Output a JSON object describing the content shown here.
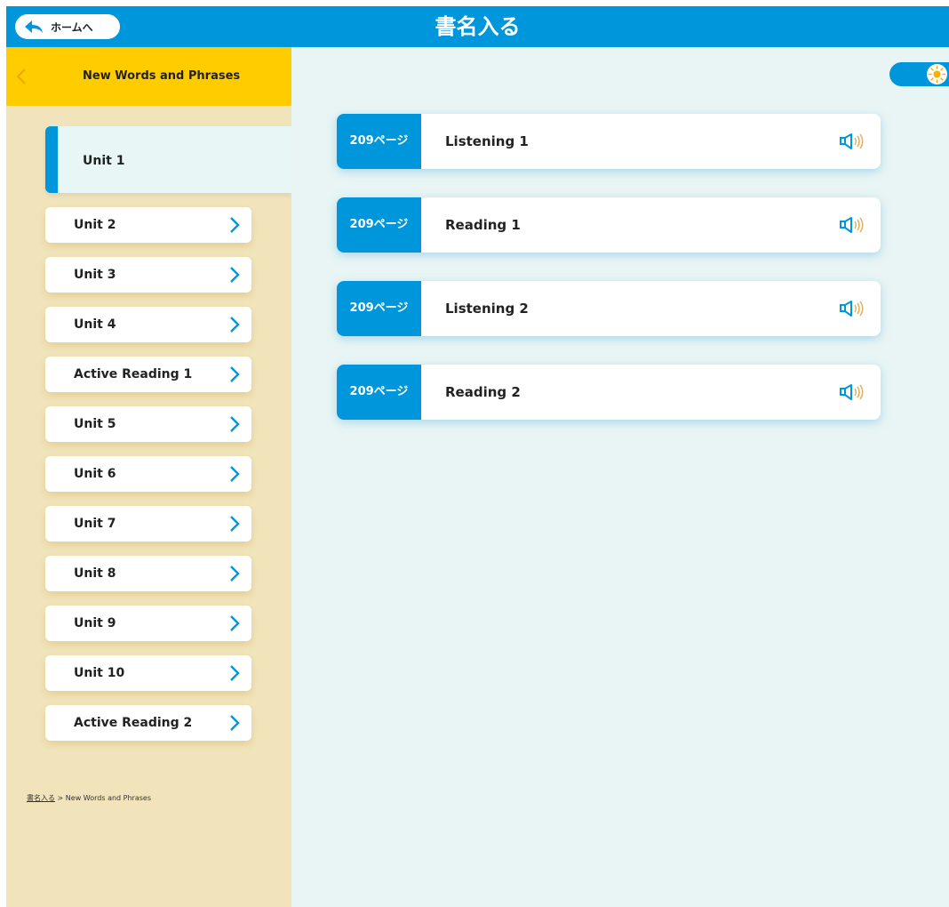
{
  "header": {
    "home_label": "ホームへ",
    "title": "書名入る"
  },
  "sidebar": {
    "title": "New Words and Phrases",
    "active_unit": "Unit 1",
    "units": [
      "Unit 2",
      "Unit 3",
      "Unit 4",
      "Active Reading 1",
      "Unit 5",
      "Unit 6",
      "Unit 7",
      "Unit 8",
      "Unit 9",
      "Unit 10",
      "Active Reading 2"
    ],
    "breadcrumb": {
      "link": "書名入る",
      "separator": ">",
      "current": "New Words and Phrases"
    }
  },
  "main": {
    "toggle_icon": "sun-icon",
    "items": [
      {
        "page": "209ページ",
        "title": "Listening 1"
      },
      {
        "page": "209ページ",
        "title": "Reading 1"
      },
      {
        "page": "209ページ",
        "title": "Listening 2"
      },
      {
        "page": "209ページ",
        "title": "Reading 2"
      }
    ]
  },
  "colors": {
    "primary_blue": "#0096dc",
    "sidebar_header_yellow": "#ffcc00",
    "sidebar_bg": "#f1e4bb",
    "main_bg": "#e8f5f4",
    "speaker_wave": "#e0b060"
  }
}
